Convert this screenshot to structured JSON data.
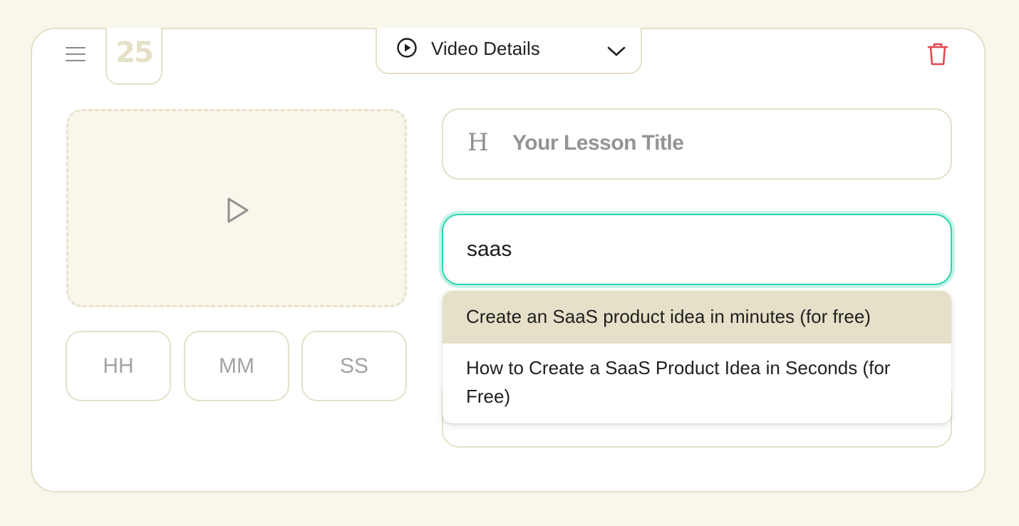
{
  "lesson": {
    "number": "25",
    "section_dropdown": {
      "label": "Video Details"
    },
    "title_placeholder": "Your Lesson Title",
    "search_value": "saas",
    "time_inputs": {
      "hours": "HH",
      "minutes": "MM",
      "seconds": "SS"
    },
    "suggestions": [
      "Create an SaaS product idea in minutes (for free)",
      "How to Create a SaaS Product Idea in Seconds (for Free)"
    ]
  },
  "icons": {
    "menu": "hamburger-icon",
    "video_details": "play-circle-icon",
    "dropdown": "chevron-down-icon",
    "delete": "trash-icon",
    "video_placeholder": "play-outline-icon",
    "title": "heading-icon"
  },
  "colors": {
    "background": "#f9f7ec",
    "card": "#ffffff",
    "border": "#e6e0c7",
    "accent_focus": "#2fd3b3",
    "highlight": "#e6e0c9",
    "delete": "#e5484d"
  }
}
